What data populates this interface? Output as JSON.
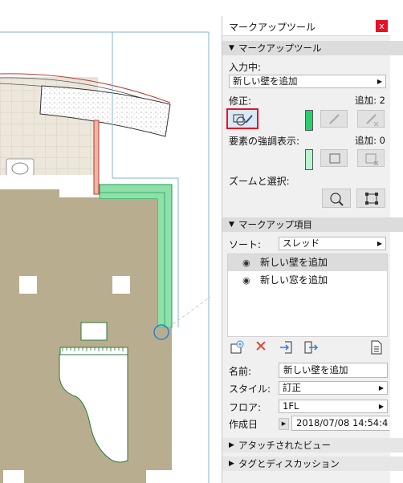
{
  "panel": {
    "title": "マークアップツール",
    "close_label": "x"
  },
  "markup_tool_section": {
    "header": "マークアップツール",
    "input_label": "入力中:",
    "input_value": "新しい壁を追加",
    "modify_label": "修正:",
    "modify_add_label": "追加: 2",
    "highlight_label": "要素の強調表示:",
    "highlight_add_label": "追加: 0",
    "zoom_select_label": "ズームと選択:"
  },
  "markup_items_section": {
    "header": "マークアップ項目",
    "sort_label": "ソート:",
    "sort_value": "スレッド",
    "items": [
      {
        "label": "新しい壁を追加",
        "selected": true
      },
      {
        "label": "新しい窓を追加",
        "selected": false
      }
    ]
  },
  "details": {
    "name_label": "名前:",
    "name_value": "新しい壁を追加",
    "style_label": "スタイル:",
    "style_value": "訂正",
    "floor_label": "フロア:",
    "floor_value": "1FL",
    "created_label": "作成日",
    "created_value": "2018/07/08 14:54:4"
  },
  "collapsed_sections": {
    "attached_views": "アタッチされたビュー",
    "tags_discussion": "タグとディスカッション"
  },
  "colors": {
    "accent_green": "#2ecc71",
    "close_red": "#e81123",
    "selected_outline": "#e81123",
    "floor_fill": "#b8ae8f"
  }
}
